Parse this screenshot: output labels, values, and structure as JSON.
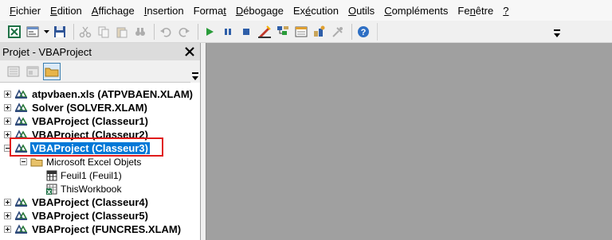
{
  "menu": [
    {
      "pre": "",
      "ul": "F",
      "post": "ichier"
    },
    {
      "pre": "",
      "ul": "E",
      "post": "dition"
    },
    {
      "pre": "",
      "ul": "A",
      "post": "ffichage"
    },
    {
      "pre": "",
      "ul": "I",
      "post": "nsertion"
    },
    {
      "pre": "Forma",
      "ul": "t",
      "post": ""
    },
    {
      "pre": "",
      "ul": "D",
      "post": "ébogage"
    },
    {
      "pre": "Ex",
      "ul": "é",
      "post": "cution"
    },
    {
      "pre": "",
      "ul": "O",
      "post": "utils"
    },
    {
      "pre": "",
      "ul": "C",
      "post": "ompléments"
    },
    {
      "pre": "Fe",
      "ul": "n",
      "post": "être"
    },
    {
      "pre": "",
      "ul": "?",
      "post": ""
    }
  ],
  "project_panel": {
    "title": "Projet - VBAProject"
  },
  "tree": {
    "items": [
      {
        "label": "atpvbaen.xls (ATPVBAEN.XLAM)",
        "expander": "plus"
      },
      {
        "label": "Solver (SOLVER.XLAM)",
        "expander": "plus"
      },
      {
        "label": "VBAProject (Classeur1)",
        "expander": "plus"
      },
      {
        "label": "VBAProject (Classeur2)",
        "expander": "plus"
      },
      {
        "label": "VBAProject (Classeur3)",
        "expander": "minus",
        "selected": true
      },
      {
        "label": "VBAProject (Classeur4)",
        "expander": "plus"
      },
      {
        "label": "VBAProject (Classeur5)",
        "expander": "plus"
      },
      {
        "label": "VBAProject (FUNCRES.XLAM)",
        "expander": "plus"
      }
    ],
    "folder": "Microsoft Excel Objets",
    "sheet": "Feuil1 (Feuil1)",
    "workbook": "ThisWorkbook"
  },
  "colors": {
    "selection": "#0078d7",
    "highlight_box": "#e01b1b",
    "code_area": "#a0a0a0"
  }
}
